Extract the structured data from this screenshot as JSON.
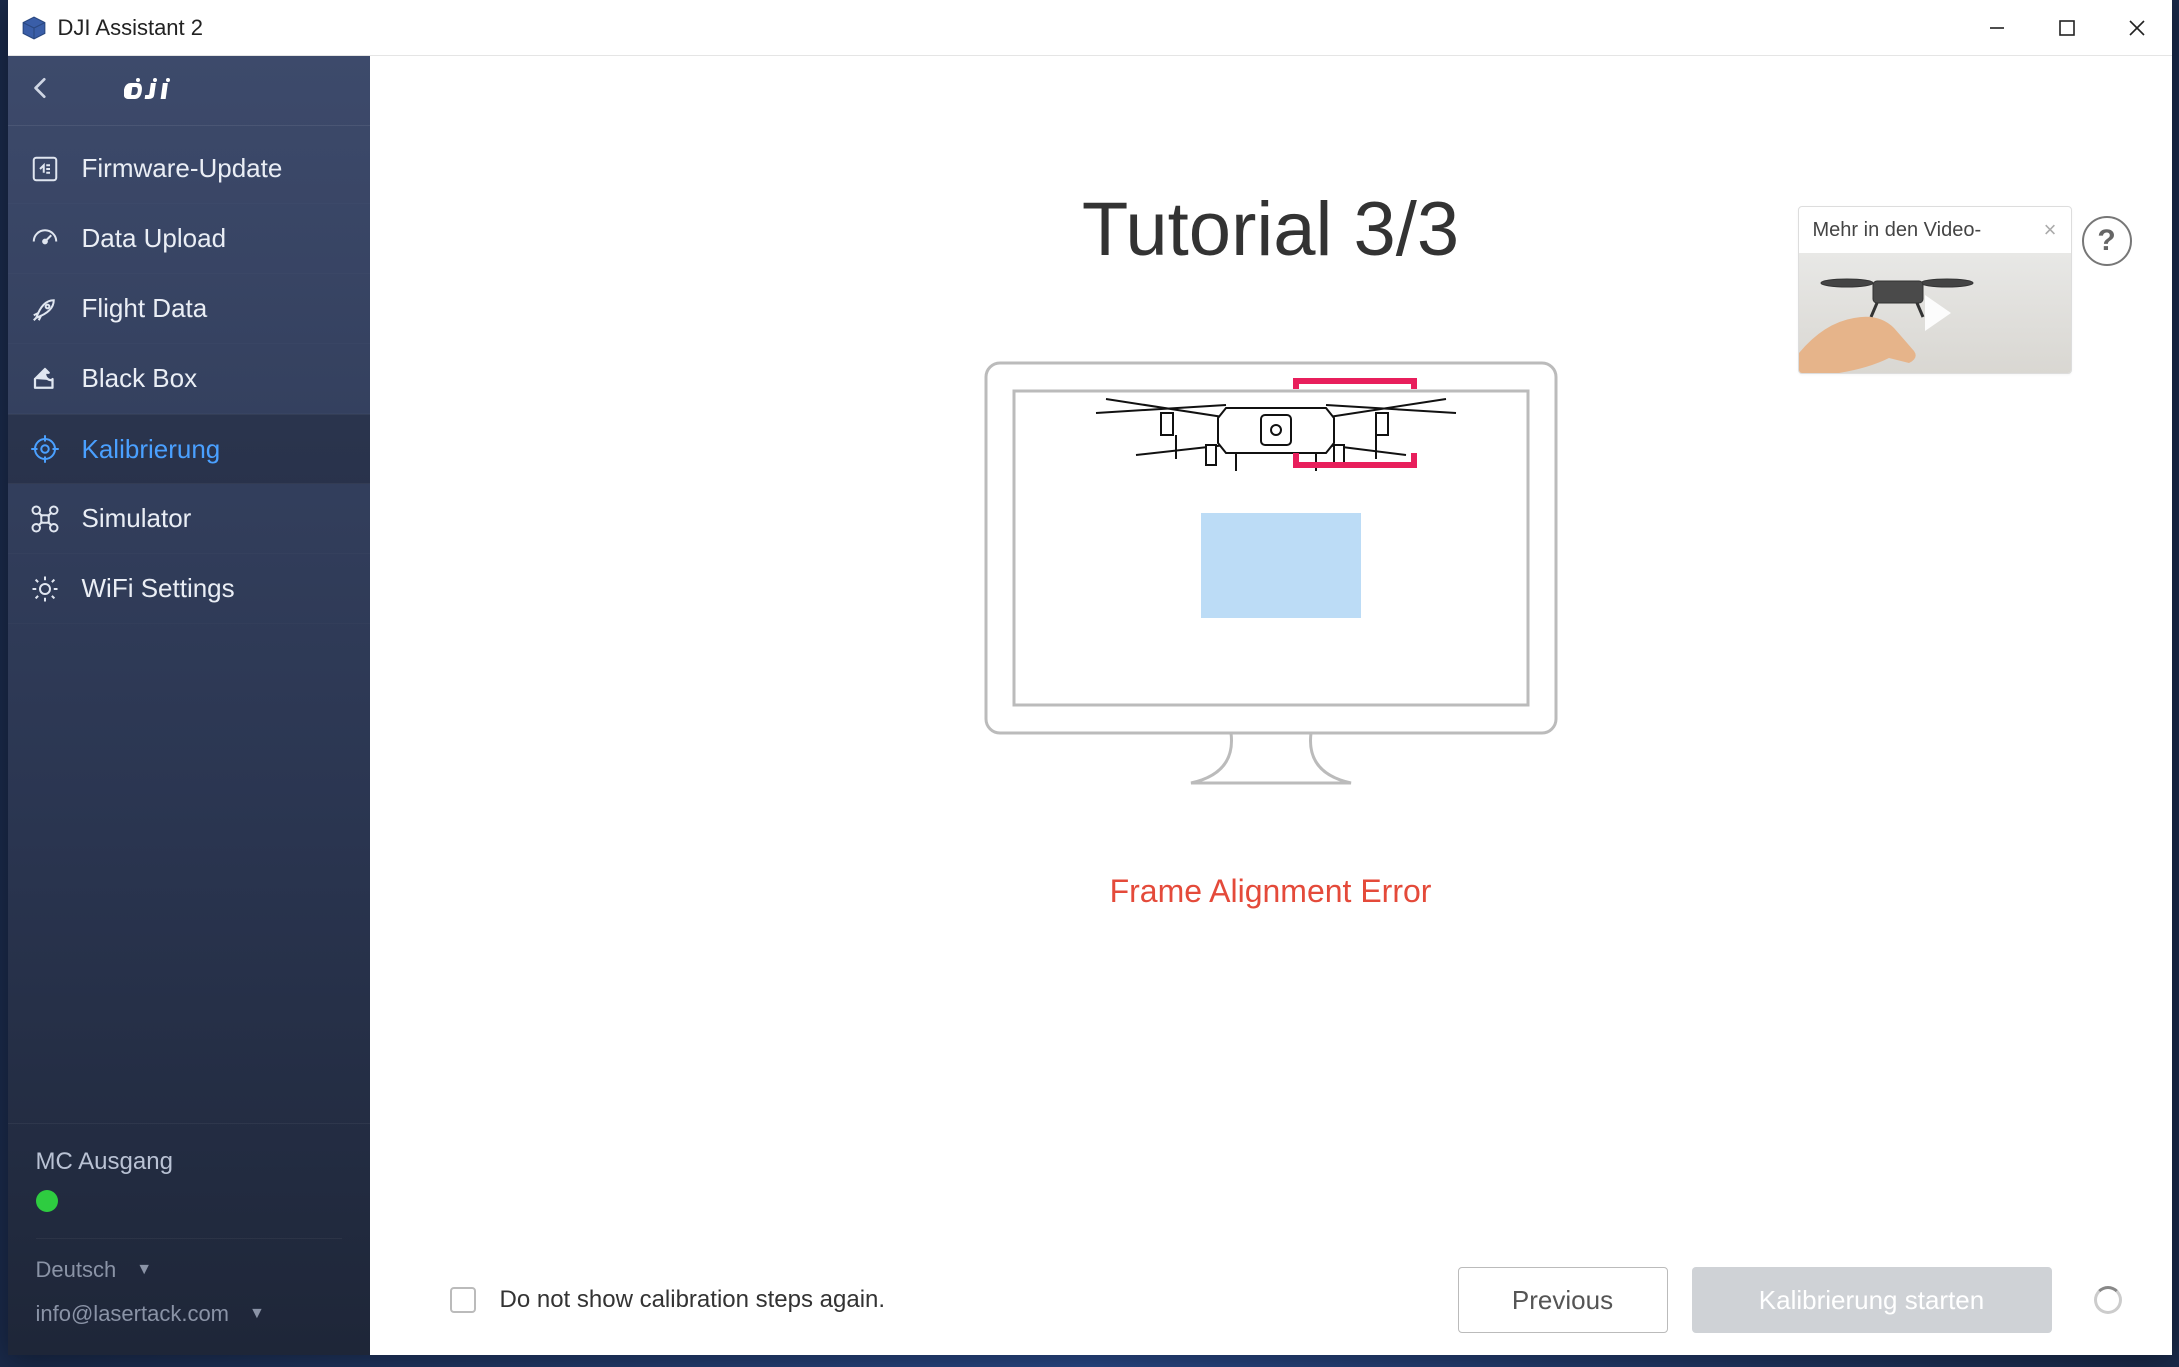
{
  "window": {
    "title": "DJI Assistant 2"
  },
  "sidebar": {
    "items": [
      {
        "label": "Firmware-Update",
        "icon": "firmware"
      },
      {
        "label": "Data Upload",
        "icon": "gauge"
      },
      {
        "label": "Flight Data",
        "icon": "rocket"
      },
      {
        "label": "Black Box",
        "icon": "share"
      },
      {
        "label": "Kalibrierung",
        "icon": "target",
        "active": true
      },
      {
        "label": "Simulator",
        "icon": "drone"
      },
      {
        "label": "WiFi Settings",
        "icon": "gear"
      }
    ],
    "mc_status_label": "MC Ausgang",
    "mc_status_ok": true,
    "language": "Deutsch",
    "account_email": "info@lasertack.com"
  },
  "main": {
    "tutorial_title": "Tutorial 3/3",
    "error_message": "Frame Alignment Error",
    "help_tip_label": "Mehr in den Video-",
    "checkbox_label": "Do not show calibration steps again.",
    "previous_button": "Previous",
    "start_button": "Kalibrierung starten"
  }
}
